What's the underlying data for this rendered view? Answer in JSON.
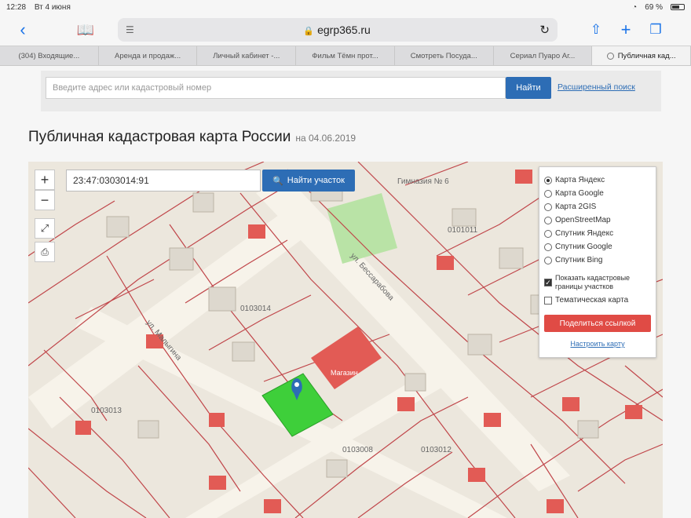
{
  "status": {
    "time": "12:28",
    "date": "Вт 4 июня",
    "battery": "69 %"
  },
  "browser": {
    "url": "egrp365.ru",
    "tabs": [
      {
        "label": "(304) Входящие..."
      },
      {
        "label": "Аренда и продаж..."
      },
      {
        "label": "Личный кабинет -..."
      },
      {
        "label": "Фильм Тёмн прот..."
      },
      {
        "label": "Смотреть Посуда..."
      },
      {
        "label": "Сериал Пуаро Аг..."
      },
      {
        "label": "Публичная кад...",
        "active": true
      }
    ]
  },
  "search": {
    "placeholder": "Введите адрес или кадастровый номер",
    "button": "Найти",
    "advanced": "Расширенный поиск"
  },
  "page": {
    "title": "Публичная кадастровая карта России",
    "date": "на 04.06.2019"
  },
  "map": {
    "zoom_in": "+",
    "zoom_out": "−",
    "cadastral_number": "23:47:0303014:91",
    "find_parcel": "Найти участок",
    "labels": {
      "school": "Гимназия № 6",
      "street1": "ул. Малыгина",
      "street2": "ул. Бессарабова",
      "block1": "0103014",
      "block2": "0103013",
      "block3": "0103008",
      "block4": "0101011",
      "block5": "0103012",
      "parcel": "Магазин"
    },
    "layers": [
      {
        "label": "Карта Яндекс",
        "selected": true
      },
      {
        "label": "Карта Google",
        "selected": false
      },
      {
        "label": "Карта 2GIS",
        "selected": false
      },
      {
        "label": "OpenStreetMap",
        "selected": false
      },
      {
        "label": "Спутник Яндекс",
        "selected": false
      },
      {
        "label": "Спутник Google",
        "selected": false
      },
      {
        "label": "Спутник Bing",
        "selected": false
      }
    ],
    "show_borders": "Показать кадастровые границы участков",
    "thematic": "Тематическая карта",
    "share": "Поделиться ссылкой",
    "configure": "Настроить карту",
    "colors": {
      "parcel_green": "#3ecf3a",
      "building_red": "#e25b55",
      "border_red": "#c0464a",
      "road": "#f7f3ea"
    }
  }
}
